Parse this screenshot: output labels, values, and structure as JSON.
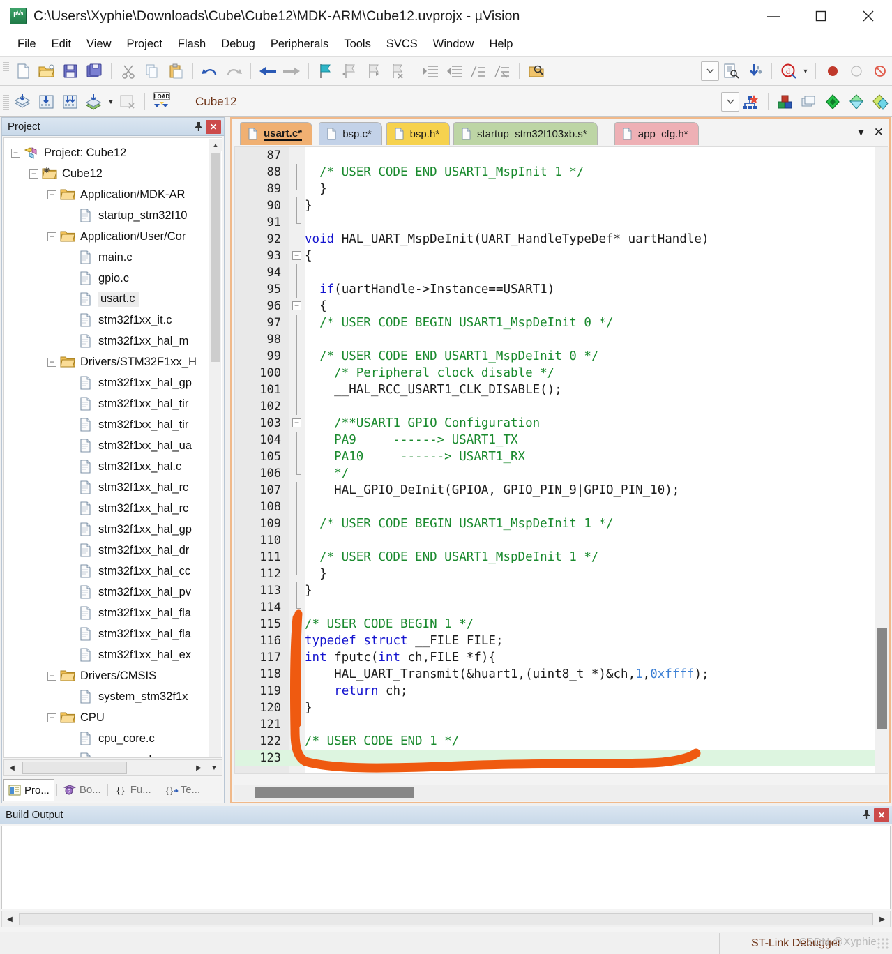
{
  "window": {
    "title": "C:\\Users\\Xyphie\\Downloads\\Cube\\Cube12\\MDK-ARM\\Cube12.uvprojx - µVision",
    "app_icon": "uvision-icon",
    "minimize_label": "—",
    "maximize_label": "□",
    "close_label": "✕"
  },
  "menu": {
    "items": [
      {
        "label": "File"
      },
      {
        "label": "Edit"
      },
      {
        "label": "View"
      },
      {
        "label": "Project"
      },
      {
        "label": "Flash"
      },
      {
        "label": "Debug"
      },
      {
        "label": "Peripherals"
      },
      {
        "label": "Tools"
      },
      {
        "label": "SVCS"
      },
      {
        "label": "Window"
      },
      {
        "label": "Help"
      }
    ]
  },
  "toolbar_main": {
    "buttons": [
      {
        "icon": "new-file-icon"
      },
      {
        "icon": "open-folder-icon"
      },
      {
        "icon": "save-icon"
      },
      {
        "icon": "save-all-icon"
      },
      {
        "icon": "cut-icon"
      },
      {
        "icon": "copy-icon"
      },
      {
        "icon": "paste-icon"
      },
      {
        "icon": "undo-icon"
      },
      {
        "icon": "redo-icon"
      },
      {
        "icon": "navigate-back-icon"
      },
      {
        "icon": "navigate-forward-icon"
      },
      {
        "icon": "bookmark-toggle-icon"
      },
      {
        "icon": "bookmark-prev-icon"
      },
      {
        "icon": "bookmark-next-icon"
      },
      {
        "icon": "bookmark-clear-icon"
      },
      {
        "icon": "indent-icon"
      },
      {
        "icon": "outdent-icon"
      },
      {
        "icon": "comment-icon"
      },
      {
        "icon": "uncomment-icon"
      },
      {
        "icon": "find-in-files-icon"
      },
      {
        "icon": "configure-toolbar-icon"
      },
      {
        "icon": "target-options-icon"
      },
      {
        "icon": "download-icon"
      },
      {
        "icon": "debug-start-icon"
      },
      {
        "icon": "breakpoint-insert-icon"
      },
      {
        "icon": "breakpoint-disable-icon"
      },
      {
        "icon": "breakpoint-disable-all-icon"
      }
    ]
  },
  "toolbar_build": {
    "buttons": [
      {
        "icon": "translate-icon"
      },
      {
        "icon": "build-icon"
      },
      {
        "icon": "rebuild-icon"
      },
      {
        "icon": "batch-build-icon"
      },
      {
        "icon": "stop-build-icon"
      },
      {
        "icon": "load-icon"
      }
    ],
    "project_selector_value": "Cube12",
    "project_selector_caret": "chevron-down-icon",
    "right_buttons": [
      {
        "icon": "target-options-wand-icon"
      },
      {
        "icon": "manage-runtime-icon"
      },
      {
        "icon": "multi-project-icon"
      },
      {
        "icon": "pack-installer-icon"
      },
      {
        "icon": "pack-filter-icon"
      },
      {
        "icon": "pack-manage-icon"
      }
    ]
  },
  "project_panel": {
    "title": "Project",
    "pin_icon": "pin-icon",
    "close_label": "✕",
    "tree": [
      {
        "depth": 0,
        "label": "Project: Cube12",
        "icon": "project-icon",
        "expander": "minus",
        "selected": false
      },
      {
        "depth": 1,
        "label": "Cube12",
        "icon": "target-icon",
        "expander": "minus",
        "selected": false
      },
      {
        "depth": 2,
        "label": "Application/MDK-AR",
        "icon": "folder-icon",
        "expander": "minus",
        "selected": false
      },
      {
        "depth": 3,
        "label": "startup_stm32f10",
        "icon": "file-icon",
        "expander": "none",
        "selected": false
      },
      {
        "depth": 2,
        "label": "Application/User/Cor",
        "icon": "folder-icon",
        "expander": "minus",
        "selected": false
      },
      {
        "depth": 3,
        "label": "main.c",
        "icon": "file-icon",
        "expander": "none",
        "selected": false
      },
      {
        "depth": 3,
        "label": "gpio.c",
        "icon": "file-icon",
        "expander": "none",
        "selected": false
      },
      {
        "depth": 3,
        "label": "usart.c",
        "icon": "file-icon",
        "expander": "none",
        "selected": true
      },
      {
        "depth": 3,
        "label": "stm32f1xx_it.c",
        "icon": "file-icon",
        "expander": "none",
        "selected": false
      },
      {
        "depth": 3,
        "label": "stm32f1xx_hal_m",
        "icon": "file-icon",
        "expander": "none",
        "selected": false
      },
      {
        "depth": 2,
        "label": "Drivers/STM32F1xx_H",
        "icon": "folder-icon",
        "expander": "minus",
        "selected": false
      },
      {
        "depth": 3,
        "label": "stm32f1xx_hal_gp",
        "icon": "file-icon",
        "expander": "none",
        "selected": false
      },
      {
        "depth": 3,
        "label": "stm32f1xx_hal_tir",
        "icon": "file-icon",
        "expander": "none",
        "selected": false
      },
      {
        "depth": 3,
        "label": "stm32f1xx_hal_tir",
        "icon": "file-icon",
        "expander": "none",
        "selected": false
      },
      {
        "depth": 3,
        "label": "stm32f1xx_hal_ua",
        "icon": "file-icon",
        "expander": "none",
        "selected": false
      },
      {
        "depth": 3,
        "label": "stm32f1xx_hal.c",
        "icon": "file-icon",
        "expander": "none",
        "selected": false
      },
      {
        "depth": 3,
        "label": "stm32f1xx_hal_rc",
        "icon": "file-icon",
        "expander": "none",
        "selected": false
      },
      {
        "depth": 3,
        "label": "stm32f1xx_hal_rc",
        "icon": "file-icon",
        "expander": "none",
        "selected": false
      },
      {
        "depth": 3,
        "label": "stm32f1xx_hal_gp",
        "icon": "file-icon",
        "expander": "none",
        "selected": false
      },
      {
        "depth": 3,
        "label": "stm32f1xx_hal_dr",
        "icon": "file-icon",
        "expander": "none",
        "selected": false
      },
      {
        "depth": 3,
        "label": "stm32f1xx_hal_cc",
        "icon": "file-icon",
        "expander": "none",
        "selected": false
      },
      {
        "depth": 3,
        "label": "stm32f1xx_hal_pv",
        "icon": "file-icon",
        "expander": "none",
        "selected": false
      },
      {
        "depth": 3,
        "label": "stm32f1xx_hal_fla",
        "icon": "file-icon",
        "expander": "none",
        "selected": false
      },
      {
        "depth": 3,
        "label": "stm32f1xx_hal_fla",
        "icon": "file-icon",
        "expander": "none",
        "selected": false
      },
      {
        "depth": 3,
        "label": "stm32f1xx_hal_ex",
        "icon": "file-icon",
        "expander": "none",
        "selected": false
      },
      {
        "depth": 2,
        "label": "Drivers/CMSIS",
        "icon": "folder-icon",
        "expander": "minus",
        "selected": false
      },
      {
        "depth": 3,
        "label": "system_stm32f1x",
        "icon": "file-icon",
        "expander": "none",
        "selected": false
      },
      {
        "depth": 2,
        "label": "CPU",
        "icon": "folder-icon",
        "expander": "minus",
        "selected": false
      },
      {
        "depth": 3,
        "label": "cpu_core.c",
        "icon": "file-icon",
        "expander": "none",
        "selected": false
      },
      {
        "depth": 3,
        "label": "cpu_core.h",
        "icon": "file-icon",
        "expander": "none",
        "selected": false
      }
    ],
    "bottom_tabs": [
      {
        "label": "Pro...",
        "icon": "project-tab-icon",
        "active": true
      },
      {
        "label": "Bo...",
        "icon": "books-tab-icon",
        "active": false
      },
      {
        "label": "Fu...",
        "icon": "functions-tab-icon",
        "active": false
      },
      {
        "label": "Te...",
        "icon": "templates-tab-icon",
        "active": false
      }
    ]
  },
  "editor": {
    "tabs": [
      {
        "label": "usart.c*",
        "color": "#f0b072",
        "active": true
      },
      {
        "label": "bsp.c*",
        "color": "#c3d2e8",
        "active": false
      },
      {
        "label": "bsp.h*",
        "color": "#f6d24e",
        "active": false
      },
      {
        "label": "startup_stm32f103xb.s*",
        "color": "#bdd5a5",
        "active": false
      },
      {
        "label": "app_cfg.h*",
        "color": "#eeb0b5",
        "active": false
      }
    ],
    "tab_tools": [
      {
        "icon": "tab-list-icon",
        "label": "▾"
      },
      {
        "icon": "tab-close-icon",
        "label": "✕"
      }
    ],
    "first_line": 87,
    "highlight_line": 123,
    "lines": [
      {
        "n": 87,
        "fold": "none",
        "segs": []
      },
      {
        "n": 88,
        "fold": "bar",
        "segs": [
          {
            "t": "  /* USER CODE END USART1_MspInit 1 */",
            "c": "cm"
          }
        ]
      },
      {
        "n": 89,
        "fold": "end",
        "segs": [
          {
            "t": "  }",
            "c": ""
          }
        ]
      },
      {
        "n": 90,
        "fold": "bar",
        "segs": [
          {
            "t": "}",
            "c": ""
          }
        ]
      },
      {
        "n": 91,
        "fold": "end",
        "segs": []
      },
      {
        "n": 92,
        "fold": "none",
        "segs": [
          {
            "t": "void",
            "c": "kw"
          },
          {
            "t": " HAL_UART_MspDeInit(UART_HandleTypeDef* uartHandle)",
            "c": ""
          }
        ]
      },
      {
        "n": 93,
        "fold": "open",
        "segs": [
          {
            "t": "{",
            "c": ""
          }
        ]
      },
      {
        "n": 94,
        "fold": "bar",
        "segs": []
      },
      {
        "n": 95,
        "fold": "bar",
        "segs": [
          {
            "t": "  ",
            "c": ""
          },
          {
            "t": "if",
            "c": "kw"
          },
          {
            "t": "(uartHandle->Instance==USART1)",
            "c": ""
          }
        ]
      },
      {
        "n": 96,
        "fold": "open",
        "segs": [
          {
            "t": "  {",
            "c": ""
          }
        ]
      },
      {
        "n": 97,
        "fold": "bar",
        "segs": [
          {
            "t": "  /* USER CODE BEGIN USART1_MspDeInit 0 */",
            "c": "cm"
          }
        ]
      },
      {
        "n": 98,
        "fold": "bar",
        "segs": []
      },
      {
        "n": 99,
        "fold": "bar",
        "segs": [
          {
            "t": "  /* USER CODE END USART1_MspDeInit 0 */",
            "c": "cm"
          }
        ]
      },
      {
        "n": 100,
        "fold": "bar",
        "segs": [
          {
            "t": "    /* Peripheral clock disable */",
            "c": "cm"
          }
        ]
      },
      {
        "n": 101,
        "fold": "bar",
        "segs": [
          {
            "t": "    __HAL_RCC_USART1_CLK_DISABLE();",
            "c": ""
          }
        ]
      },
      {
        "n": 102,
        "fold": "bar",
        "segs": []
      },
      {
        "n": 103,
        "fold": "open",
        "segs": [
          {
            "t": "    /**USART1 GPIO Configuration",
            "c": "cm"
          }
        ]
      },
      {
        "n": 104,
        "fold": "bar",
        "segs": [
          {
            "t": "    PA9     ------> USART1_TX",
            "c": "cm"
          }
        ]
      },
      {
        "n": 105,
        "fold": "bar",
        "segs": [
          {
            "t": "    PA10     ------> USART1_RX",
            "c": "cm"
          }
        ]
      },
      {
        "n": 106,
        "fold": "end",
        "segs": [
          {
            "t": "    */",
            "c": "cm"
          }
        ]
      },
      {
        "n": 107,
        "fold": "bar",
        "segs": [
          {
            "t": "    HAL_GPIO_DeInit(GPIOA, GPIO_PIN_9|GPIO_PIN_10);",
            "c": ""
          }
        ]
      },
      {
        "n": 108,
        "fold": "bar",
        "segs": []
      },
      {
        "n": 109,
        "fold": "bar",
        "segs": [
          {
            "t": "  /* USER CODE BEGIN USART1_MspDeInit 1 */",
            "c": "cm"
          }
        ]
      },
      {
        "n": 110,
        "fold": "bar",
        "segs": []
      },
      {
        "n": 111,
        "fold": "bar",
        "segs": [
          {
            "t": "  /* USER CODE END USART1_MspDeInit 1 */",
            "c": "cm"
          }
        ]
      },
      {
        "n": 112,
        "fold": "end",
        "segs": [
          {
            "t": "  }",
            "c": ""
          }
        ]
      },
      {
        "n": 113,
        "fold": "bar",
        "segs": [
          {
            "t": "}",
            "c": ""
          }
        ]
      },
      {
        "n": 114,
        "fold": "end",
        "segs": []
      },
      {
        "n": 115,
        "fold": "none",
        "segs": [
          {
            "t": "/* USER CODE BEGIN 1 */",
            "c": "cm"
          }
        ]
      },
      {
        "n": 116,
        "fold": "none",
        "segs": [
          {
            "t": "typedef",
            "c": "kw"
          },
          {
            "t": " ",
            "c": ""
          },
          {
            "t": "struct",
            "c": "kw"
          },
          {
            "t": " __FILE FILE;",
            "c": ""
          }
        ]
      },
      {
        "n": 117,
        "fold": "open",
        "segs": [
          {
            "t": "int",
            "c": "kw"
          },
          {
            "t": " fputc(",
            "c": ""
          },
          {
            "t": "int",
            "c": "kw"
          },
          {
            "t": " ch,FILE *f){",
            "c": ""
          }
        ]
      },
      {
        "n": 118,
        "fold": "bar",
        "segs": [
          {
            "t": "    HAL_UART_Transmit(&huart1,(uint8_t *)&ch,",
            "c": ""
          },
          {
            "t": "1",
            "c": "num"
          },
          {
            "t": ",",
            "c": ""
          },
          {
            "t": "0xffff",
            "c": "num"
          },
          {
            "t": ");",
            "c": ""
          }
        ]
      },
      {
        "n": 119,
        "fold": "bar",
        "segs": [
          {
            "t": "    ",
            "c": ""
          },
          {
            "t": "return",
            "c": "kw"
          },
          {
            "t": " ch;",
            "c": ""
          }
        ]
      },
      {
        "n": 120,
        "fold": "end",
        "segs": [
          {
            "t": "}",
            "c": ""
          }
        ]
      },
      {
        "n": 121,
        "fold": "end",
        "segs": []
      },
      {
        "n": 122,
        "fold": "none",
        "segs": [
          {
            "t": "/* USER CODE END 1 */",
            "c": "cm"
          }
        ]
      },
      {
        "n": 123,
        "fold": "none",
        "segs": []
      }
    ]
  },
  "annotation": {
    "color": "#ef5a10",
    "shape": "hand-drawn-bracket"
  },
  "build_output": {
    "title": "Build Output",
    "pin_icon": "pin-icon",
    "close_label": "✕",
    "content": ""
  },
  "status": {
    "debugger": "ST-Link Debugger",
    "watermark": "CSDN @Xyphie"
  },
  "colors": {
    "accent_orange": "#ef5a10",
    "comment_green": "#1a8a2e",
    "keyword_blue": "#1515cf",
    "number_blue": "#3b7fd4",
    "highlight_line": "#ddf5e0",
    "panel_blue": "#c9d9e9"
  }
}
